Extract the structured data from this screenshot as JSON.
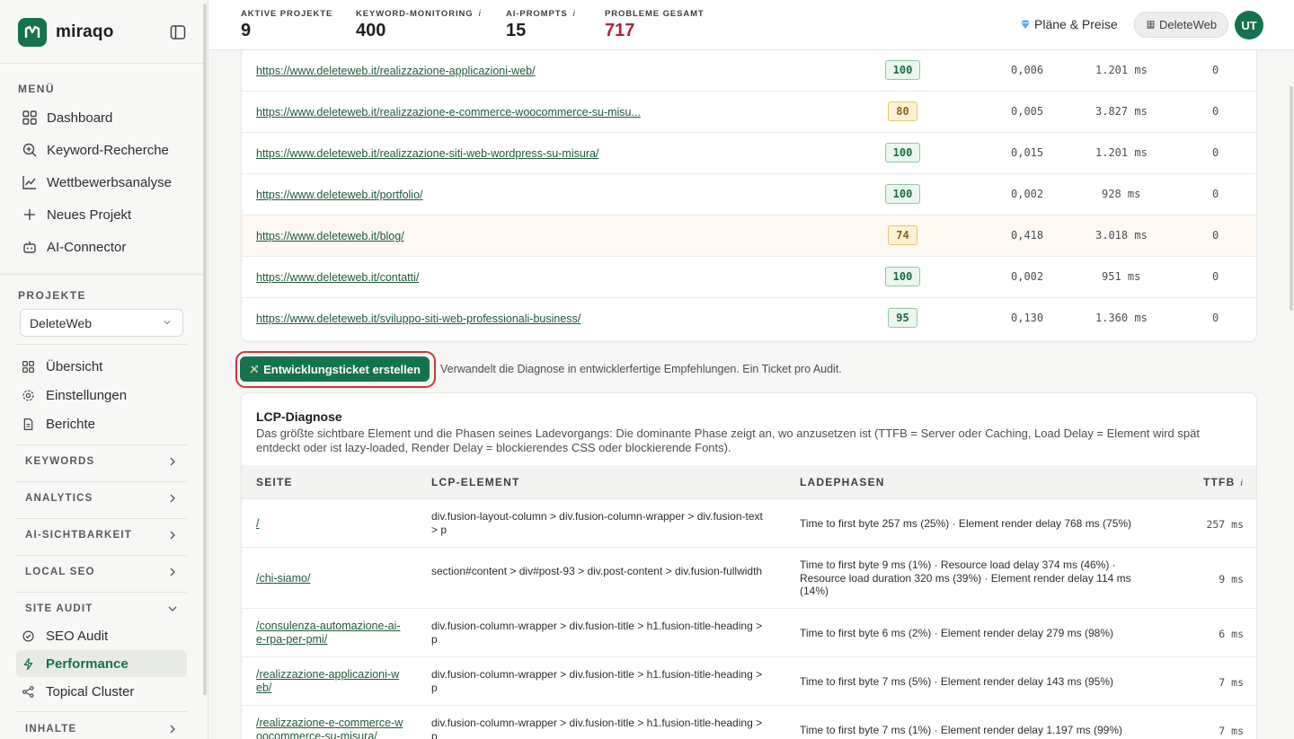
{
  "brand": {
    "name": "miraqo",
    "color": "#14734f"
  },
  "sidebar": {
    "menu_title": "MENÜ",
    "menu": [
      {
        "label": "Dashboard",
        "icon": "grid-icon"
      },
      {
        "label": "Keyword-Recherche",
        "icon": "search-plus-icon"
      },
      {
        "label": "Wettbewerbsanalyse",
        "icon": "line-chart-icon"
      },
      {
        "label": "Neues Projekt",
        "icon": "plus-icon"
      },
      {
        "label": "AI-Connector",
        "icon": "robot-icon"
      }
    ],
    "projects_title": "PROJEKTE",
    "project_select": "DeleteWeb",
    "project_items": [
      {
        "label": "Übersicht",
        "icon": "grid-icon"
      },
      {
        "label": "Einstellungen",
        "icon": "gear-icon"
      },
      {
        "label": "Berichte",
        "icon": "document-icon"
      }
    ],
    "groups": {
      "keywords": "KEYWORDS",
      "analytics": "ANALYTICS",
      "ai": "AI-SICHTBARKEIT",
      "local": "LOCAL SEO",
      "audit": "SITE AUDIT",
      "content": "INHALTE"
    },
    "audit_items": [
      {
        "label": "SEO Audit",
        "icon": "check-circle-icon"
      },
      {
        "label": "Performance",
        "icon": "bolt-icon"
      },
      {
        "label": "Topical Cluster",
        "icon": "share-icon"
      }
    ]
  },
  "topbar": {
    "stats": [
      {
        "label": "AKTIVE PROJEKTE",
        "value": "9",
        "info": ""
      },
      {
        "label": "KEYWORD-MONITORING",
        "value": "400",
        "info": "i"
      },
      {
        "label": "AI-PROMPTS",
        "value": "15",
        "info": "i"
      },
      {
        "label": "PROBLEME GESAMT",
        "value": "717",
        "info": ""
      }
    ],
    "plans_label": "Pläne & Preise",
    "project_chip": "DeleteWeb",
    "avatar_initials": "UT"
  },
  "pages_table": {
    "rows": [
      {
        "url": "https://www.deleteweb.it/realizzazione-applicazioni-web/",
        "score": "100",
        "cls": "0,006",
        "time": "1.201 ms",
        "count": "0"
      },
      {
        "url": "https://www.deleteweb.it/realizzazione-e-commerce-woocommerce-su-misu...",
        "score": "80",
        "cls": "0,005",
        "time": "3.827 ms",
        "count": "0"
      },
      {
        "url": "https://www.deleteweb.it/realizzazione-siti-web-wordpress-su-misura/",
        "score": "100",
        "cls": "0,015",
        "time": "1.201 ms",
        "count": "0"
      },
      {
        "url": "https://www.deleteweb.it/portfolio/",
        "score": "100",
        "cls": "0,002",
        "time": "928 ms",
        "count": "0"
      },
      {
        "url": "https://www.deleteweb.it/blog/",
        "score": "74",
        "cls": "0,418",
        "time": "3.018 ms",
        "count": "0"
      },
      {
        "url": "https://www.deleteweb.it/contatti/",
        "score": "100",
        "cls": "0,002",
        "time": "951 ms",
        "count": "0"
      },
      {
        "url": "https://www.deleteweb.it/sviluppo-siti-web-professionali-business/",
        "score": "95",
        "cls": "0,130",
        "time": "1.360 ms",
        "count": "0"
      }
    ]
  },
  "ticket": {
    "button": "Entwicklungsticket erstellen",
    "hint": "Verwandelt die Diagnose in entwicklerfertige Empfehlungen. Ein Ticket pro Audit."
  },
  "lcp": {
    "title": "LCP-Diagnose",
    "description": "Das größte sichtbare Element und die Phasen seines Ladevorgangs: Die dominante Phase zeigt an, wo anzusetzen ist (TTFB = Server oder Caching, Load Delay = Element wird spät entdeckt oder ist lazy-loaded, Render Delay = blockierendes CSS oder blockierende Fonts).",
    "columns": {
      "page": "SEITE",
      "element": "LCP-ELEMENT",
      "phases": "LADEPHASEN",
      "ttfb": "TTFB",
      "ttfb_info": "i"
    },
    "rows": [
      {
        "page": "/",
        "element": "div.fusion-layout-column > div.fusion-column-wrapper > div.fusion-text > p",
        "phases": "Time to first byte 257 ms (25%) · Element render delay 768 ms (75%)",
        "ttfb": "257 ms"
      },
      {
        "page": "/chi-siamo/",
        "element": "section#content > div#post-93 > div.post-content > div.fusion-fullwidth",
        "phases": "Time to first byte 9 ms (1%) · Resource load delay 374 ms (46%) · Resource load duration 320 ms (39%) · Element render delay 114 ms (14%)",
        "ttfb": "9 ms"
      },
      {
        "page": "/consulenza-automazione-ai-e-rpa-per-pmi/",
        "element": "div.fusion-column-wrapper > div.fusion-title > h1.fusion-title-heading > p",
        "phases": "Time to first byte 6 ms (2%) · Element render delay 279 ms (98%)",
        "ttfb": "6 ms"
      },
      {
        "page": "/realizzazione-applicazioni-web/",
        "element": "div.fusion-column-wrapper > div.fusion-title > h1.fusion-title-heading > p",
        "phases": "Time to first byte 7 ms (5%) · Element render delay 143 ms (95%)",
        "ttfb": "7 ms"
      },
      {
        "page": "/realizzazione-e-commerce-woocommerce-su-misura/",
        "element": "div.fusion-column-wrapper > div.fusion-title > h1.fusion-title-heading > p",
        "phases": "Time to first byte 7 ms (1%) · Element render delay 1.197 ms (99%)",
        "ttfb": "7 ms"
      }
    ]
  }
}
